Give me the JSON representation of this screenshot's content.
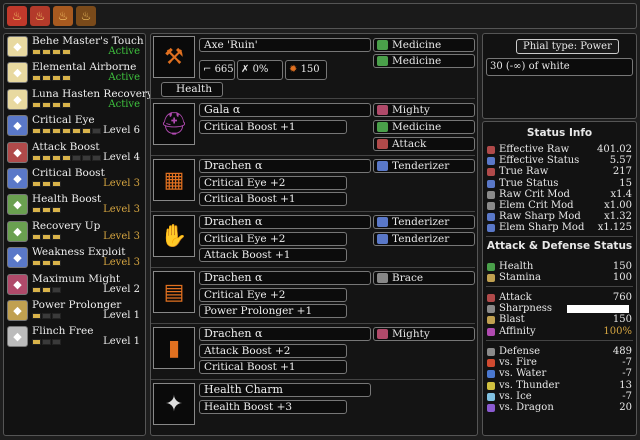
{
  "top_icons": [
    {
      "name": "monster-icon-1",
      "glyph": "♨"
    },
    {
      "name": "monster-icon-2",
      "glyph": "♨"
    },
    {
      "name": "monster-icon-3",
      "glyph": "♨"
    },
    {
      "name": "monster-icon-4",
      "glyph": "♨"
    }
  ],
  "skills": [
    {
      "name": "Behe Master's Touch",
      "level": "Active",
      "filled": 4,
      "total": 4,
      "color": "#e8d9a0",
      "style": "active"
    },
    {
      "name": "Elemental Airborne",
      "level": "Active",
      "filled": 4,
      "total": 4,
      "color": "#e8d9a0",
      "style": "active"
    },
    {
      "name": "Luna Hasten Recovery",
      "level": "Active",
      "filled": 4,
      "total": 4,
      "color": "#e8d9a0",
      "style": "active"
    },
    {
      "name": "Critical Eye",
      "level": "Level 6",
      "filled": 6,
      "total": 7,
      "color": "#5a78c8",
      "style": "normal"
    },
    {
      "name": "Attack Boost",
      "level": "Level 4",
      "filled": 4,
      "total": 7,
      "color": "#b04a4a",
      "style": "normal"
    },
    {
      "name": "Critical Boost",
      "level": "Level 3",
      "filled": 3,
      "total": 3,
      "color": "#5a78c8",
      "style": "gold"
    },
    {
      "name": "Health Boost",
      "level": "Level 3",
      "filled": 3,
      "total": 3,
      "color": "#6aa050",
      "style": "gold"
    },
    {
      "name": "Recovery Up",
      "level": "Level 3",
      "filled": 3,
      "total": 3,
      "color": "#6aa050",
      "style": "gold"
    },
    {
      "name": "Weakness Exploit",
      "level": "Level 3",
      "filled": 3,
      "total": 3,
      "color": "#5a78c8",
      "style": "gold"
    },
    {
      "name": "Maximum Might",
      "level": "Level 2",
      "filled": 2,
      "total": 3,
      "color": "#b04a6a",
      "style": "normal"
    },
    {
      "name": "Power Prolonger",
      "level": "Level 1",
      "filled": 1,
      "total": 3,
      "color": "#c0a050",
      "style": "normal"
    },
    {
      "name": "Flinch Free",
      "level": "Level 1",
      "filled": 1,
      "total": 3,
      "color": "#bbbbbb",
      "style": "normal"
    }
  ],
  "weapon": {
    "name": "Axe 'Ruin'",
    "sharpness": "665",
    "affinity": "0%",
    "attack": "150",
    "tab": "Health",
    "decos": [
      {
        "name": "Medicine",
        "color": "#4aa04a"
      },
      {
        "name": "Medicine",
        "color": "#4aa04a"
      }
    ]
  },
  "armor": [
    {
      "name": "Gala α",
      "skills": [
        "Critical Boost +1"
      ],
      "color": "#b04ab0",
      "glyph": "⛑",
      "decos": [
        {
          "name": "Mighty",
          "color": "#b04a6a"
        },
        {
          "name": "Medicine",
          "color": "#4aa04a"
        },
        {
          "name": "Attack",
          "color": "#b04a4a"
        }
      ]
    },
    {
      "name": "Drachen α",
      "skills": [
        "Critical Eye +2",
        "Critical Boost +1"
      ],
      "color": "#e07020",
      "glyph": "▦",
      "decos": [
        {
          "name": "Tenderizer",
          "color": "#5a78c8"
        }
      ]
    },
    {
      "name": "Drachen α",
      "skills": [
        "Critical Eye +2",
        "Attack Boost +1"
      ],
      "color": "#e07020",
      "glyph": "✋",
      "decos": [
        {
          "name": "Tenderizer",
          "color": "#5a78c8"
        },
        {
          "name": "Tenderizer",
          "color": "#5a78c8"
        }
      ]
    },
    {
      "name": "Drachen α",
      "skills": [
        "Critical Eye +2",
        "Power Prolonger +1"
      ],
      "color": "#e07020",
      "glyph": "▤",
      "decos": [
        {
          "name": "Brace",
          "color": "#888888"
        }
      ]
    },
    {
      "name": "Drachen α",
      "skills": [
        "Attack Boost +2",
        "Critical Boost +1"
      ],
      "color": "#e07020",
      "glyph": "▮",
      "decos": [
        {
          "name": "Mighty",
          "color": "#b04a6a"
        }
      ]
    },
    {
      "name": "Health Charm",
      "skills": [
        "Health Boost +3"
      ],
      "color": "#dddddd",
      "glyph": "✦",
      "decos": []
    }
  ],
  "phial": {
    "label": "Phial type: Power",
    "value": "30 (-∞) of white"
  },
  "status": {
    "title": "Status Info",
    "rows": [
      {
        "label": "Effective Raw",
        "value": "401.02",
        "color": "#b04a4a"
      },
      {
        "label": "Effective Status",
        "value": "5.57",
        "color": "#5a78c8"
      },
      {
        "label": "True Raw",
        "value": "217",
        "color": "#b04a4a"
      },
      {
        "label": "True Status",
        "value": "15",
        "color": "#5a78c8"
      },
      {
        "label": "Raw Crit Mod",
        "value": "x1.4",
        "color": "#8a8a8a"
      },
      {
        "label": "Elem Crit Mod",
        "value": "x1.00",
        "color": "#8a8a8a"
      },
      {
        "label": "Raw Sharp Mod",
        "value": "x1.32",
        "color": "#5a78c8"
      },
      {
        "label": "Elem Sharp Mod",
        "value": "x1.125",
        "color": "#5a78c8"
      }
    ],
    "ad_title": "Attack & Defense Status",
    "vitals": [
      {
        "label": "Health",
        "value": "150",
        "color": "#4aa04a"
      },
      {
        "label": "Stamina",
        "value": "100",
        "color": "#c0a050"
      }
    ],
    "offense": [
      {
        "label": "Attack",
        "value": "760",
        "color": "#b04a4a",
        "gold": false
      },
      {
        "label": "Sharpness",
        "value": "",
        "color": "#8a8a8a",
        "gold": false,
        "sharp": true
      },
      {
        "label": "Blast",
        "value": "150",
        "color": "#c0a050",
        "gold": false
      },
      {
        "label": "Affinity",
        "value": "100%",
        "color": "#b04ab0",
        "gold": true
      }
    ],
    "defense": [
      {
        "label": "Defense",
        "value": "489",
        "color": "#8a8a8a"
      },
      {
        "label": "vs. Fire",
        "value": "-7",
        "color": "#d04a30"
      },
      {
        "label": "vs. Water",
        "value": "-7",
        "color": "#4a78d0"
      },
      {
        "label": "vs. Thunder",
        "value": "13",
        "color": "#d0c040"
      },
      {
        "label": "vs. Ice",
        "value": "-7",
        "color": "#80c0e0"
      },
      {
        "label": "vs. Dragon",
        "value": "20",
        "color": "#8a5ad0"
      }
    ]
  }
}
